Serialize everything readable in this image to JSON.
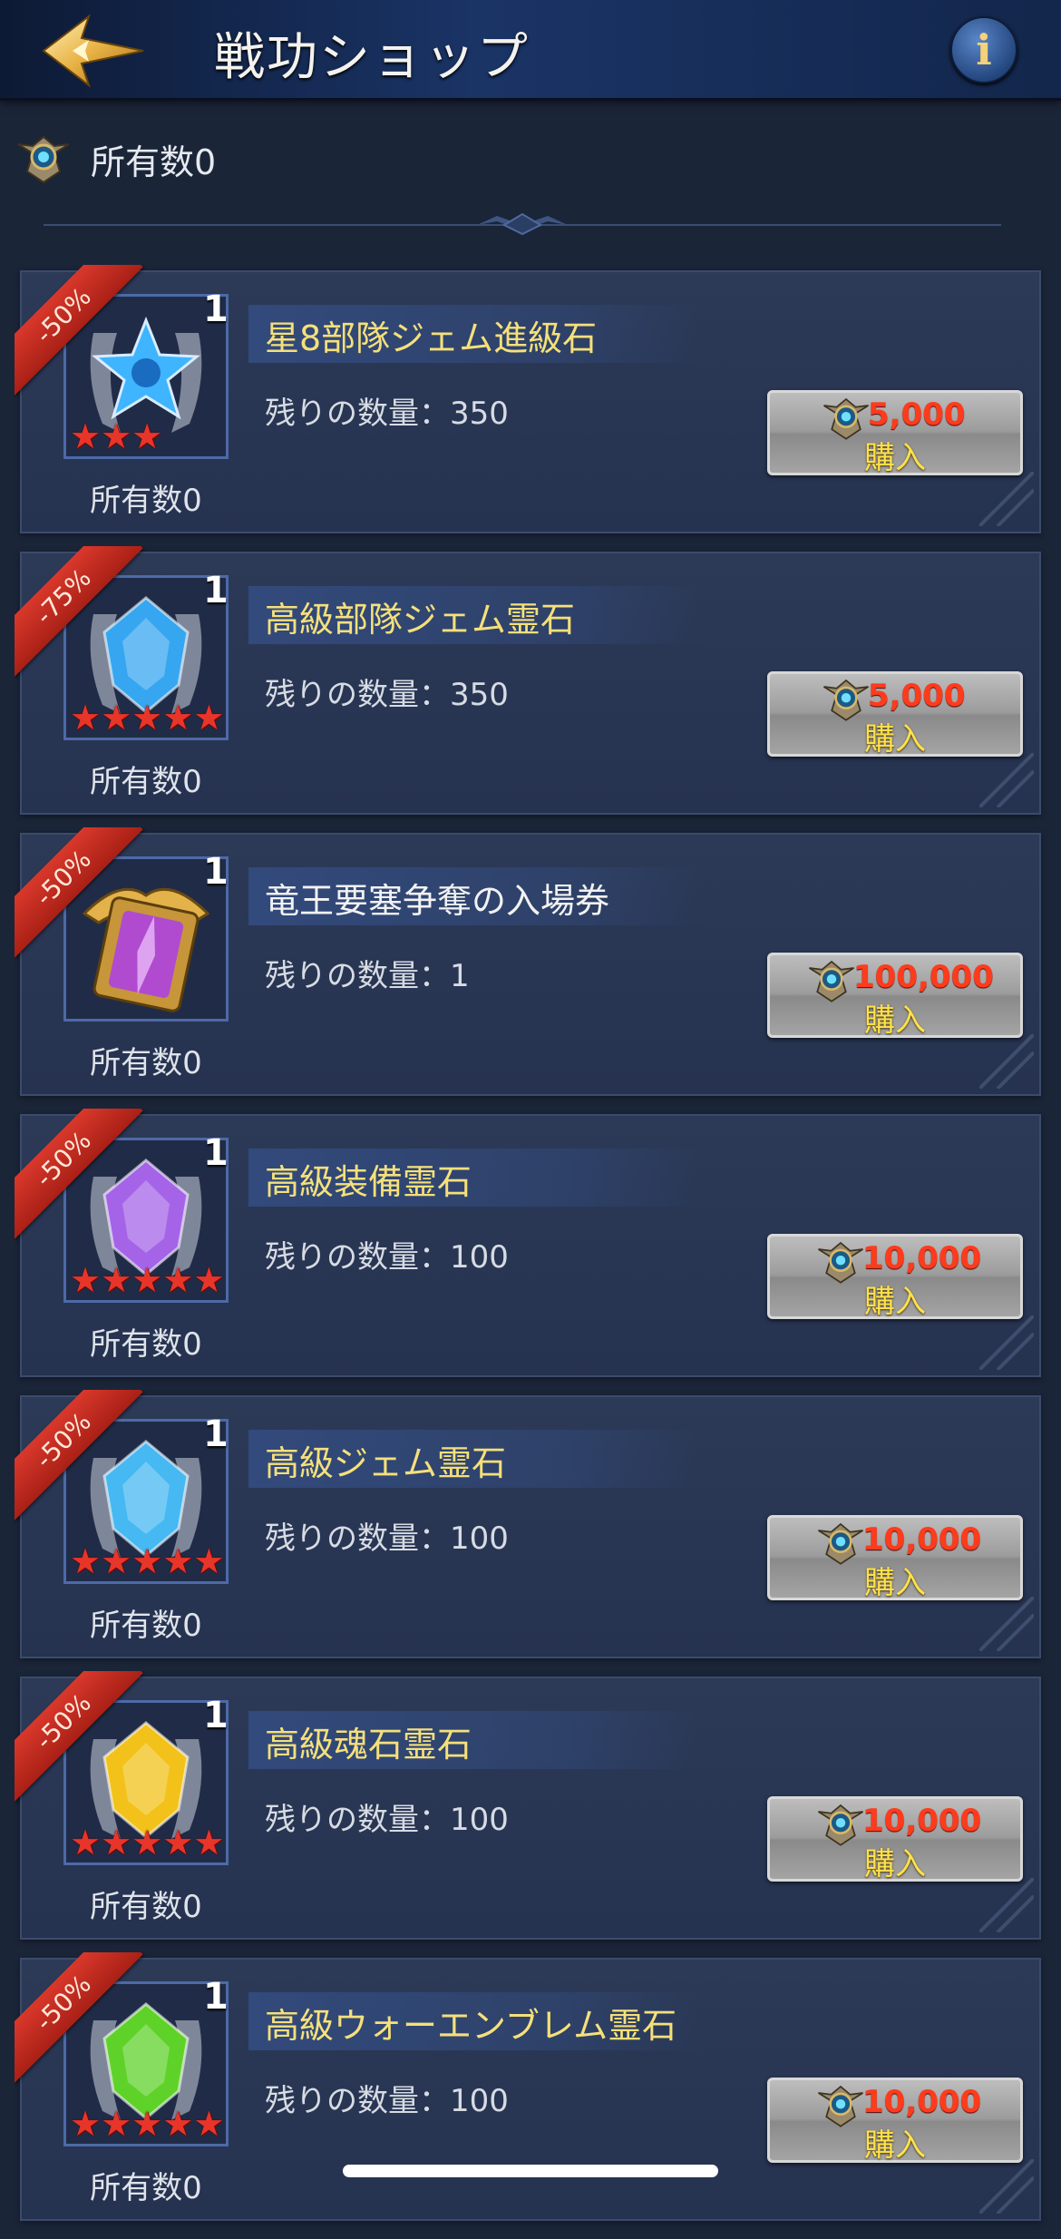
{
  "header": {
    "title": "戦功ショップ",
    "info_label": "i"
  },
  "owned": {
    "label": "所有数0"
  },
  "items": [
    {
      "discount": "-50%",
      "qty": "1",
      "name": "星8部隊ジェム進級石",
      "name_color": "yellow",
      "remaining": "残りの数量：350",
      "price": "5,000",
      "buy": "購入",
      "owned": "所有数0",
      "stars": 3,
      "gem": "blue-star"
    },
    {
      "discount": "-75%",
      "qty": "1",
      "name": "高級部隊ジェム霊石",
      "name_color": "yellow",
      "remaining": "残りの数量：350",
      "price": "5,000",
      "buy": "購入",
      "owned": "所有数0",
      "stars": 5,
      "gem": "blue"
    },
    {
      "discount": "-50%",
      "qty": "1",
      "name": "竜王要塞争奪の入場券",
      "name_color": "white",
      "remaining": "残りの数量：1",
      "price": "100,000",
      "buy": "購入",
      "owned": "所有数0",
      "stars": 0,
      "gem": "ticket"
    },
    {
      "discount": "-50%",
      "qty": "1",
      "name": "高級装備霊石",
      "name_color": "yellow",
      "remaining": "残りの数量：100",
      "price": "10,000",
      "buy": "購入",
      "owned": "所有数0",
      "stars": 5,
      "gem": "purple"
    },
    {
      "discount": "-50%",
      "qty": "1",
      "name": "高級ジェム霊石",
      "name_color": "yellow",
      "remaining": "残りの数量：100",
      "price": "10,000",
      "buy": "購入",
      "owned": "所有数0",
      "stars": 5,
      "gem": "cyan"
    },
    {
      "discount": "-50%",
      "qty": "1",
      "name": "高級魂石霊石",
      "name_color": "yellow",
      "remaining": "残りの数量：100",
      "price": "10,000",
      "buy": "購入",
      "owned": "所有数0",
      "stars": 5,
      "gem": "yellow"
    },
    {
      "discount": "-50%",
      "qty": "1",
      "name": "高級ウォーエンブレム霊石",
      "name_color": "yellow",
      "remaining": "残りの数量：100",
      "price": "10,000",
      "buy": "購入",
      "owned": "所有数0",
      "stars": 5,
      "gem": "green"
    }
  ],
  "colors": {
    "blue-star": "#3fb4ff",
    "blue": "#37a6f0",
    "ticket": "#b04bd0",
    "purple": "#a564e8",
    "cyan": "#46b8f2",
    "yellow": "#f2c21a",
    "green": "#5fd22a"
  }
}
